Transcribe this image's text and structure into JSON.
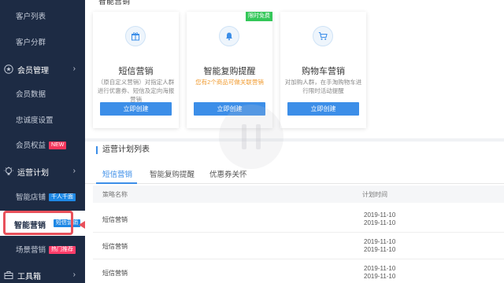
{
  "sidebar": {
    "customer_list": "客户列表",
    "customer_group": "客户分群",
    "member_mgmt": "会员管理",
    "member_data": "会员数据",
    "loyalty": "忠诚度设置",
    "member_rights": "会员权益",
    "member_rights_badge": "NEW",
    "ops_plan": "运营计划",
    "smart_store": "智能店铺",
    "smart_store_badge": "千人千面",
    "smart_marketing": "智能营销",
    "smart_marketing_badge": "短信营销",
    "scene_marketing": "场景营销",
    "scene_marketing_badge": "热门推荐",
    "toolbox": "工具箱"
  },
  "main": {
    "section_title": "智能营销",
    "cards": [
      {
        "title": "短信营销",
        "desc": "（原自定义营销）对指定人群进行优惠券、短信及定向海报营销",
        "button": "立即创建",
        "icon": "gift-icon"
      },
      {
        "title": "智能复购提醒",
        "desc": "您有2个商品可做关联营销",
        "button": "立即创建",
        "tag": "限时免费",
        "icon": "bell-icon"
      },
      {
        "title": "购物车营销",
        "desc": "对加购人群，在手淘购物车进行限时活动提醒",
        "button": "立即创建",
        "icon": "cart-icon"
      }
    ],
    "plan_title": "运营计划列表",
    "tabs": [
      "短信营销",
      "智能复购提醒",
      "优惠券关怀"
    ],
    "table": {
      "headers": [
        "策略名称",
        "计划时间"
      ],
      "rows": [
        {
          "name": "短信营销",
          "time1": "2019-11-10",
          "time2": "2019-11-10"
        },
        {
          "name": "短信营销",
          "time1": "2019-11-10",
          "time2": "2019-11-10"
        },
        {
          "name": "短信营销",
          "time1": "2019-11-10",
          "time2": "2019-11-10"
        }
      ]
    }
  },
  "colors": {
    "sidebar_bg": "#1d2b44",
    "accent": "#3c8ee8",
    "highlight": "#e8505b",
    "new_badge": "#f5365c",
    "limited_tag": "#34c759"
  }
}
